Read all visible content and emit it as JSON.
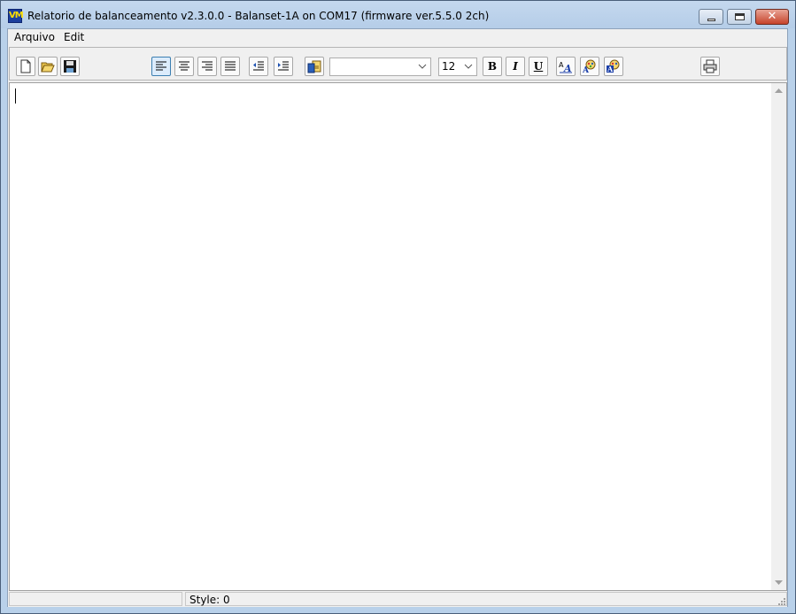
{
  "window": {
    "title": "Relatorio de balanceamento v2.3.0.0 - Balanset-1A on COM17 (firmware ver.5.5.0 2ch)",
    "app_icon_text": "VM"
  },
  "menu": {
    "items": [
      "Arquivo",
      "Edit"
    ]
  },
  "toolbar": {
    "icons": [
      "new-document-icon",
      "open-folder-icon",
      "save-icon",
      "align-left-icon",
      "align-center-icon",
      "align-right-icon",
      "justify-icon",
      "outdent-icon",
      "indent-icon",
      "insert-picture-icon",
      "bold-icon",
      "italic-icon",
      "underline-icon",
      "font-icon",
      "text-color-icon",
      "background-color-icon",
      "print-icon"
    ],
    "font_name": "",
    "font_size": "12",
    "bold_label": "B",
    "italic_label": "I",
    "underline_label": "U"
  },
  "status": {
    "style_text": "Style: 0"
  },
  "colors": {
    "titlebar": "#c4d8ee",
    "close_button": "#c7432b",
    "active_button": "#dcecfc"
  }
}
